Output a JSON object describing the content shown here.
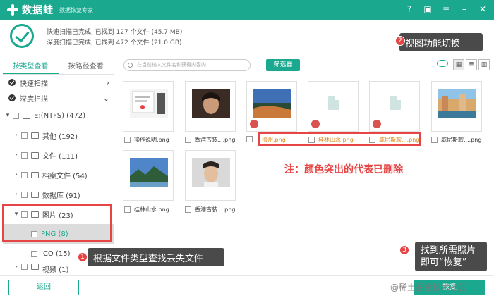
{
  "app": {
    "title": "数据蛙",
    "subtitle": "数据恢复专家"
  },
  "window_controls": [
    "help-icon",
    "save-icon",
    "menu-icon",
    "minimize-icon",
    "close-icon"
  ],
  "summary": {
    "quick_scan": "快速扫描已完成, 已找到 127 个文件 (45.7 MB)",
    "deep_scan": "深度扫描已完成, 已找到 472 个文件 (21.0 GB)"
  },
  "sidebar": {
    "tabs": [
      "按类型查看",
      "按路径查看"
    ],
    "active_tab": 0,
    "scans": [
      "快速扫描",
      "深度扫描"
    ],
    "tree": {
      "root": "E:(NTFS) (472)",
      "items": [
        "其他 (192)",
        "文件 (111)",
        "档案文件 (54)",
        "数据库 (91)",
        "图片 (23)"
      ],
      "children": [
        "PNG (8)",
        "ICO (15)"
      ],
      "partial": "视频 (1)"
    }
  },
  "toolbar": {
    "search_placeholder": "在当前输入文件名和获得内容内",
    "filter_label": "筛选器",
    "views": [
      "grid-view-icon",
      "list-view-icon",
      "detail-view-icon"
    ]
  },
  "files": [
    {
      "name": "操作说明.png",
      "deleted": false
    },
    {
      "name": "香港古装....png",
      "deleted": false
    },
    {
      "name": "梅州.png",
      "deleted": true
    },
    {
      "name": "桂林山水.png",
      "deleted": true
    },
    {
      "name": "威尼斯款....png",
      "deleted": true
    },
    {
      "name": "威尼斯款....png",
      "deleted": false
    },
    {
      "name": "桂林山水.png",
      "deleted": false
    },
    {
      "name": "香港古装....png",
      "deleted": false
    }
  ],
  "annotations": {
    "view_switch": {
      "num": "2",
      "text": "视图功能切换"
    },
    "note": "注：颜色突出的代表已删除",
    "find_by_type": {
      "num": "1",
      "text": "根据文件类型查找丢失文件"
    },
    "recover": {
      "num": "3",
      "line1": "找到所需照片",
      "line2": "即可“恢复”"
    }
  },
  "footer": {
    "back_label": "返回",
    "recover_label": "恢复"
  },
  "watermark": "@稀土掘金技术社区",
  "colors": {
    "brand": "#1aa88f",
    "annotation_red": "#e64545",
    "deleted_text": "#e08a1e"
  }
}
